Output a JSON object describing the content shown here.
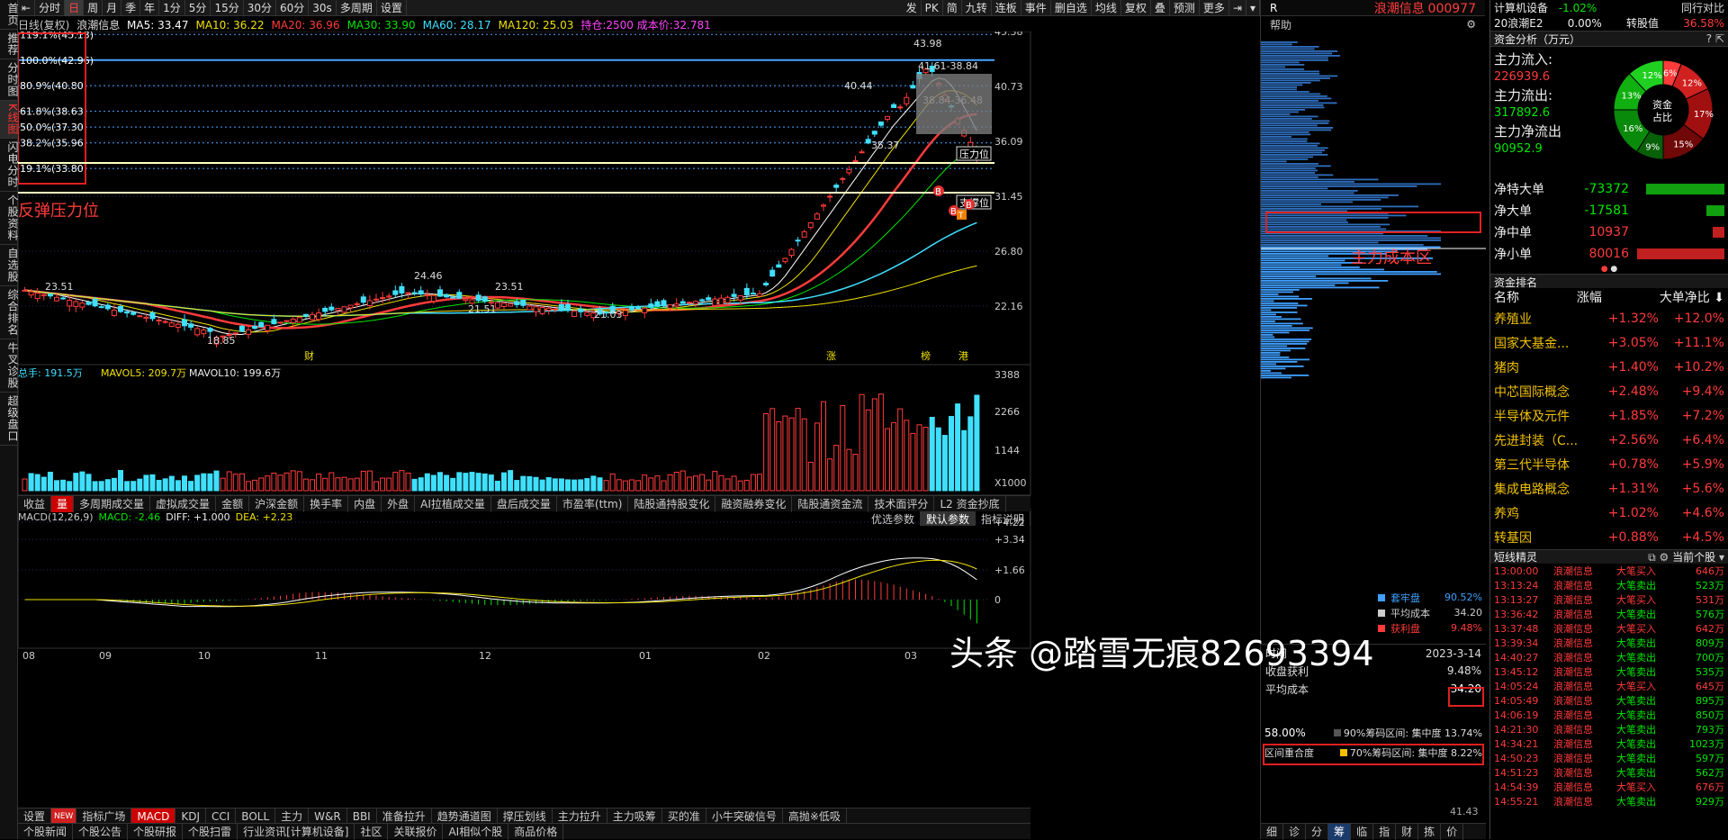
{
  "left_nav": [
    "首页",
    "推荐",
    "分时图",
    "K线图",
    "闪电分时",
    "个股资料",
    "自选股",
    "综合排名",
    "牛叉诊股",
    "超级盘口"
  ],
  "toolbar": {
    "periods": [
      "分时",
      "日",
      "周",
      "月",
      "季",
      "年",
      "1分",
      "5分",
      "15分",
      "30分",
      "60分",
      "30s",
      "多周期",
      "设置"
    ],
    "right_tools": [
      "发",
      "PK",
      "简",
      "九转",
      "连板",
      "事件",
      "删自选",
      "均线",
      "复权",
      "叠",
      "预测",
      "更多"
    ]
  },
  "ma_line": {
    "title": "日线(复权)",
    "stock": "浪潮信息",
    "items": [
      {
        "label": "MA5: 33.47",
        "color": "#ffffff"
      },
      {
        "label": "MA10: 36.22",
        "color": "#f0e000"
      },
      {
        "label": "MA20: 36.96",
        "color": "#ff3b3b"
      },
      {
        "label": "MA30: 33.90",
        "color": "#00e600"
      },
      {
        "label": "MA60: 28.17",
        "color": "#3fe0ff"
      },
      {
        "label": "MA120: 25.03",
        "color": "#f0e000"
      },
      {
        "label": "持仓:2500 成本价:32.781",
        "color": "#ff44ff"
      }
    ]
  },
  "fib_levels": [
    {
      "label": "119.1%(45.13)",
      "price": 45.13,
      "color": "#4aa3ff"
    },
    {
      "label": "100.0%(42.96)",
      "price": 42.96,
      "color": "#4aa3ff"
    },
    {
      "label": "80.9%(40.80)",
      "price": 40.8,
      "color": "#4aa3ff"
    },
    {
      "label": "61.8%(38.63)",
      "price": 38.63,
      "color": "#4aa3ff"
    },
    {
      "label": "50.0%(37.30)",
      "price": 37.3,
      "color": "#4aa3ff"
    },
    {
      "label": "38.2%(35.96)",
      "price": 35.96,
      "color": "#4aa3ff"
    },
    {
      "label": "19.1%(33.80)",
      "price": 33.8,
      "color": "#4aa3ff"
    }
  ],
  "annotations": {
    "rebound_pressure": "反弹压力位",
    "main_cost_zone": "主力成本区",
    "pressure_tag": "压力位",
    "support_tag": "支撑位",
    "watermark": "头条 @踏雪无痕82693394"
  },
  "price_axis": [
    "45.38",
    "40.73",
    "36.09",
    "31.45",
    "26.80",
    "22.16"
  ],
  "price_marks": [
    "43.98",
    "41.61-38.84",
    "38.84-36.48",
    "40.44",
    "35.37",
    "24.46",
    "23.51",
    "23.51",
    "21.51",
    "21.03",
    "18.85"
  ],
  "event_marks": [
    "财",
    "涨",
    "榜",
    "港"
  ],
  "volume": {
    "header": {
      "total": "总手: 191.5万",
      "mavol5": "MAVOL5: 209.7万",
      "mavol10": "MAVOL10: 199.6万"
    },
    "axis": [
      "3388",
      "2266",
      "1144",
      "X1000"
    ]
  },
  "indicator_tabs": [
    "收益",
    "量",
    "多周期成交量",
    "虚拟成交量",
    "金额",
    "沪深金额",
    "换手率",
    "内盘",
    "外盘",
    "AI拉植成交量",
    "盘后成交量",
    "市盈率(ttm)",
    "陆股通持股变化",
    "融资融券变化",
    "陆股通资金流",
    "技术面评分",
    "L2 资金抄底"
  ],
  "macd": {
    "header": {
      "title": "MACD(12,26,9)",
      "macd": "MACD: -2.46",
      "diff": "DIFF: +1.000",
      "dea": "DEA: +2.23"
    },
    "axis": [
      "+4.22",
      "+3.34",
      "+1.66",
      "0"
    ],
    "buttons": [
      "优选参数",
      "默认参数",
      "指标说明"
    ]
  },
  "time_axis": [
    "08",
    "09",
    "10",
    "11",
    "12",
    "01",
    "02",
    "03"
  ],
  "bottom_tabs": [
    "设置",
    "NEW",
    "指标广场",
    "MACD",
    "KDJ",
    "CCI",
    "BOLL",
    "主力",
    "W&R",
    "BBI",
    "准备拉升",
    "趋势通道图",
    "撑压划线",
    "主力拉升",
    "主力吸筹",
    "买的准",
    "小牛突破信号",
    "高抛※低吸"
  ],
  "status_tabs": [
    "个股新闻",
    "个股公告",
    "个股研报",
    "个股扫雷",
    "行业资讯[计算机设备]",
    "社区",
    "关联报价",
    "AI相似个股",
    "商品价格"
  ],
  "chip_panel": {
    "r_label": "R",
    "stock_name": "浪潮信息",
    "stock_code": "000977",
    "help": "帮助",
    "legend": [
      {
        "label": "套牢盘",
        "value": "90.52%",
        "color": "#3fa0ff"
      },
      {
        "label": "平均成本",
        "value": "34.20",
        "color": "#cccccc"
      },
      {
        "label": "获利盘",
        "value": "9.48%",
        "color": "#ff3b3b"
      }
    ],
    "rows": [
      {
        "label": "时间",
        "value": "2023-3-14"
      },
      {
        "label": "收盘获利",
        "value": "9.48%"
      },
      {
        "label": "平均成本",
        "value": "34.20"
      }
    ],
    "concentration": [
      {
        "left": "58.00%",
        "label": "90%筹码区间:",
        "sub": "集中度",
        "value": "13.74%"
      },
      {
        "left": "区间重合度",
        "label": "70%筹码区间:",
        "sub": "集中度",
        "value": "8.22%"
      }
    ],
    "price_footer": "41.43",
    "bottom_tabs": [
      "细",
      "诊",
      "分",
      "筹",
      "临",
      "指",
      "财",
      "拣",
      "价"
    ]
  },
  "far_right": {
    "sector": {
      "name": "计算机设备",
      "change": "-1.02%",
      "extra": "同行对比"
    },
    "index": {
      "name": "20浪潮E2",
      "change": "0.00%",
      "label": "转股值",
      "value": "36.58%"
    },
    "fund_title": "资金分析（万元）",
    "inflow_label": "主力流入:",
    "inflow": "226939.6",
    "outflow_label": "主力流出:",
    "outflow": "317892.6",
    "net_label": "主力净流出",
    "net": "90952.9",
    "donut_center": "资金占比",
    "donut": [
      {
        "label": "6%",
        "value": 6,
        "color": "#ff3b3b"
      },
      {
        "label": "12%",
        "value": 12,
        "color": "#d02020"
      },
      {
        "label": "17%",
        "value": 17,
        "color": "#a01010"
      },
      {
        "label": "15%",
        "value": 15,
        "color": "#700808"
      },
      {
        "label": "9%",
        "value": 9,
        "color": "#086008"
      },
      {
        "label": "16%",
        "value": 16,
        "color": "#0a8a0a"
      },
      {
        "label": "13%",
        "value": 13,
        "color": "#10b010"
      },
      {
        "label": "12%",
        "value": 12,
        "color": "#20d020"
      }
    ],
    "flows": [
      {
        "label": "净特大单",
        "value": "-73372",
        "color": "#00e600",
        "bar": 0.85
      },
      {
        "label": "净大单",
        "value": "-17581",
        "color": "#00e600",
        "bar": 0.2
      },
      {
        "label": "净中单",
        "value": "10937",
        "color": "#ff3b3b",
        "bar": 0.13
      },
      {
        "label": "净小单",
        "value": "80016",
        "color": "#ff3b3b",
        "bar": 0.95
      }
    ],
    "rank_title": "资金排名",
    "rank_header": [
      "名称",
      "涨幅",
      "大单净比"
    ],
    "ranks": [
      {
        "name": "养殖业",
        "chg": "+1.32%",
        "net": "+12.0%"
      },
      {
        "name": "国家大基金...",
        "chg": "+3.05%",
        "net": "+11.1%"
      },
      {
        "name": "猪肉",
        "chg": "+1.40%",
        "net": "+10.2%"
      },
      {
        "name": "中芯国际概念",
        "chg": "+2.48%",
        "net": "+9.4%"
      },
      {
        "name": "半导体及元件",
        "chg": "+1.85%",
        "net": "+7.2%"
      },
      {
        "name": "先进封装（C...",
        "chg": "+2.56%",
        "net": "+6.4%"
      },
      {
        "name": "第三代半导体",
        "chg": "+0.78%",
        "net": "+5.9%"
      },
      {
        "name": "集成电路概念",
        "chg": "+1.31%",
        "net": "+5.6%"
      },
      {
        "name": "养鸡",
        "chg": "+1.02%",
        "net": "+4.6%"
      },
      {
        "name": "转基因",
        "chg": "+0.88%",
        "net": "+4.5%"
      }
    ],
    "elf_title": "短线精灵",
    "elf_filter": "当前个股",
    "trades": [
      {
        "time": "13:00:00",
        "name": "浪潮信息",
        "action": "大笔买入",
        "amount": "646万",
        "buy": true
      },
      {
        "time": "13:13:24",
        "name": "浪潮信息",
        "action": "大笔卖出",
        "amount": "523万",
        "buy": false
      },
      {
        "time": "13:13:27",
        "name": "浪潮信息",
        "action": "大笔买入",
        "amount": "531万",
        "buy": true
      },
      {
        "time": "13:36:42",
        "name": "浪潮信息",
        "action": "大笔卖出",
        "amount": "576万",
        "buy": false
      },
      {
        "time": "13:37:48",
        "name": "浪潮信息",
        "action": "大笔买入",
        "amount": "642万",
        "buy": true
      },
      {
        "time": "13:39:34",
        "name": "浪潮信息",
        "action": "大笔卖出",
        "amount": "809万",
        "buy": false
      },
      {
        "time": "14:40:27",
        "name": "浪潮信息",
        "action": "大笔卖出",
        "amount": "700万",
        "buy": false
      },
      {
        "time": "13:45:12",
        "name": "浪潮信息",
        "action": "大笔卖出",
        "amount": "535万",
        "buy": false
      },
      {
        "time": "14:05:24",
        "name": "浪潮信息",
        "action": "大笔买入",
        "amount": "645万",
        "buy": true
      },
      {
        "time": "14:05:49",
        "name": "浪潮信息",
        "action": "大笔卖出",
        "amount": "895万",
        "buy": false
      },
      {
        "time": "14:06:19",
        "name": "浪潮信息",
        "action": "大笔卖出",
        "amount": "850万",
        "buy": false
      },
      {
        "time": "14:21:30",
        "name": "浪潮信息",
        "action": "大笔卖出",
        "amount": "793万",
        "buy": false
      },
      {
        "time": "14:34:21",
        "name": "浪潮信息",
        "action": "大笔卖出",
        "amount": "1023万",
        "buy": false
      },
      {
        "time": "14:50:23",
        "name": "浪潮信息",
        "action": "大笔卖出",
        "amount": "597万",
        "buy": false
      },
      {
        "time": "14:51:23",
        "name": "浪潮信息",
        "action": "大笔卖出",
        "amount": "562万",
        "buy": false
      },
      {
        "time": "14:54:39",
        "name": "浪潮信息",
        "action": "大笔买入",
        "amount": "676万",
        "buy": true
      },
      {
        "time": "14:55:21",
        "name": "浪潮信息",
        "action": "大笔卖出",
        "amount": "929万",
        "buy": false
      }
    ]
  }
}
